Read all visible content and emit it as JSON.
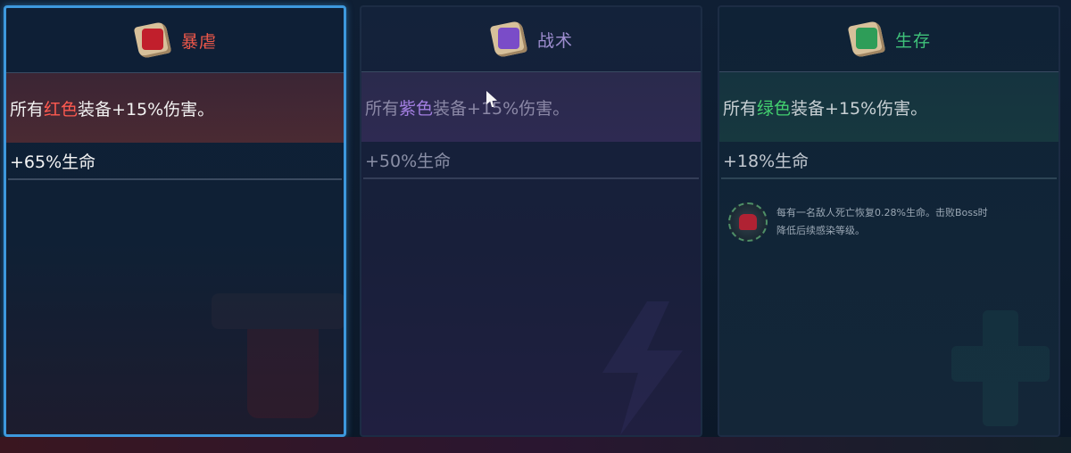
{
  "panels": [
    {
      "title": "暴虐",
      "icon": "fist-scroll-icon",
      "desc_prefix": "所有",
      "desc_color_word": "红色",
      "desc_suffix": "装备+15%伤害。",
      "stat": "+65%生命",
      "selected": true
    },
    {
      "title": "战术",
      "icon": "lightning-scroll-icon",
      "desc_prefix": "所有",
      "desc_color_word": "紫色",
      "desc_suffix": "装备+15%伤害。",
      "stat": "+50%生命",
      "selected": false
    },
    {
      "title": "生存",
      "icon": "cross-scroll-icon",
      "desc_prefix": "所有",
      "desc_color_word": "绿色",
      "desc_suffix": "装备+15%伤害。",
      "stat": "+18%生命",
      "selected": false,
      "trait": {
        "icon": "survival-trait-icon",
        "line1": "每有一名敌人死亡恢复0.28%生命。击败Boss时",
        "line2": "降低后续感染等级。"
      }
    }
  ],
  "colors": {
    "brutality": "#f0584a",
    "tactics": "#9e8ed0",
    "survival": "#3fc27a",
    "selected_border": "#3d98dd"
  }
}
